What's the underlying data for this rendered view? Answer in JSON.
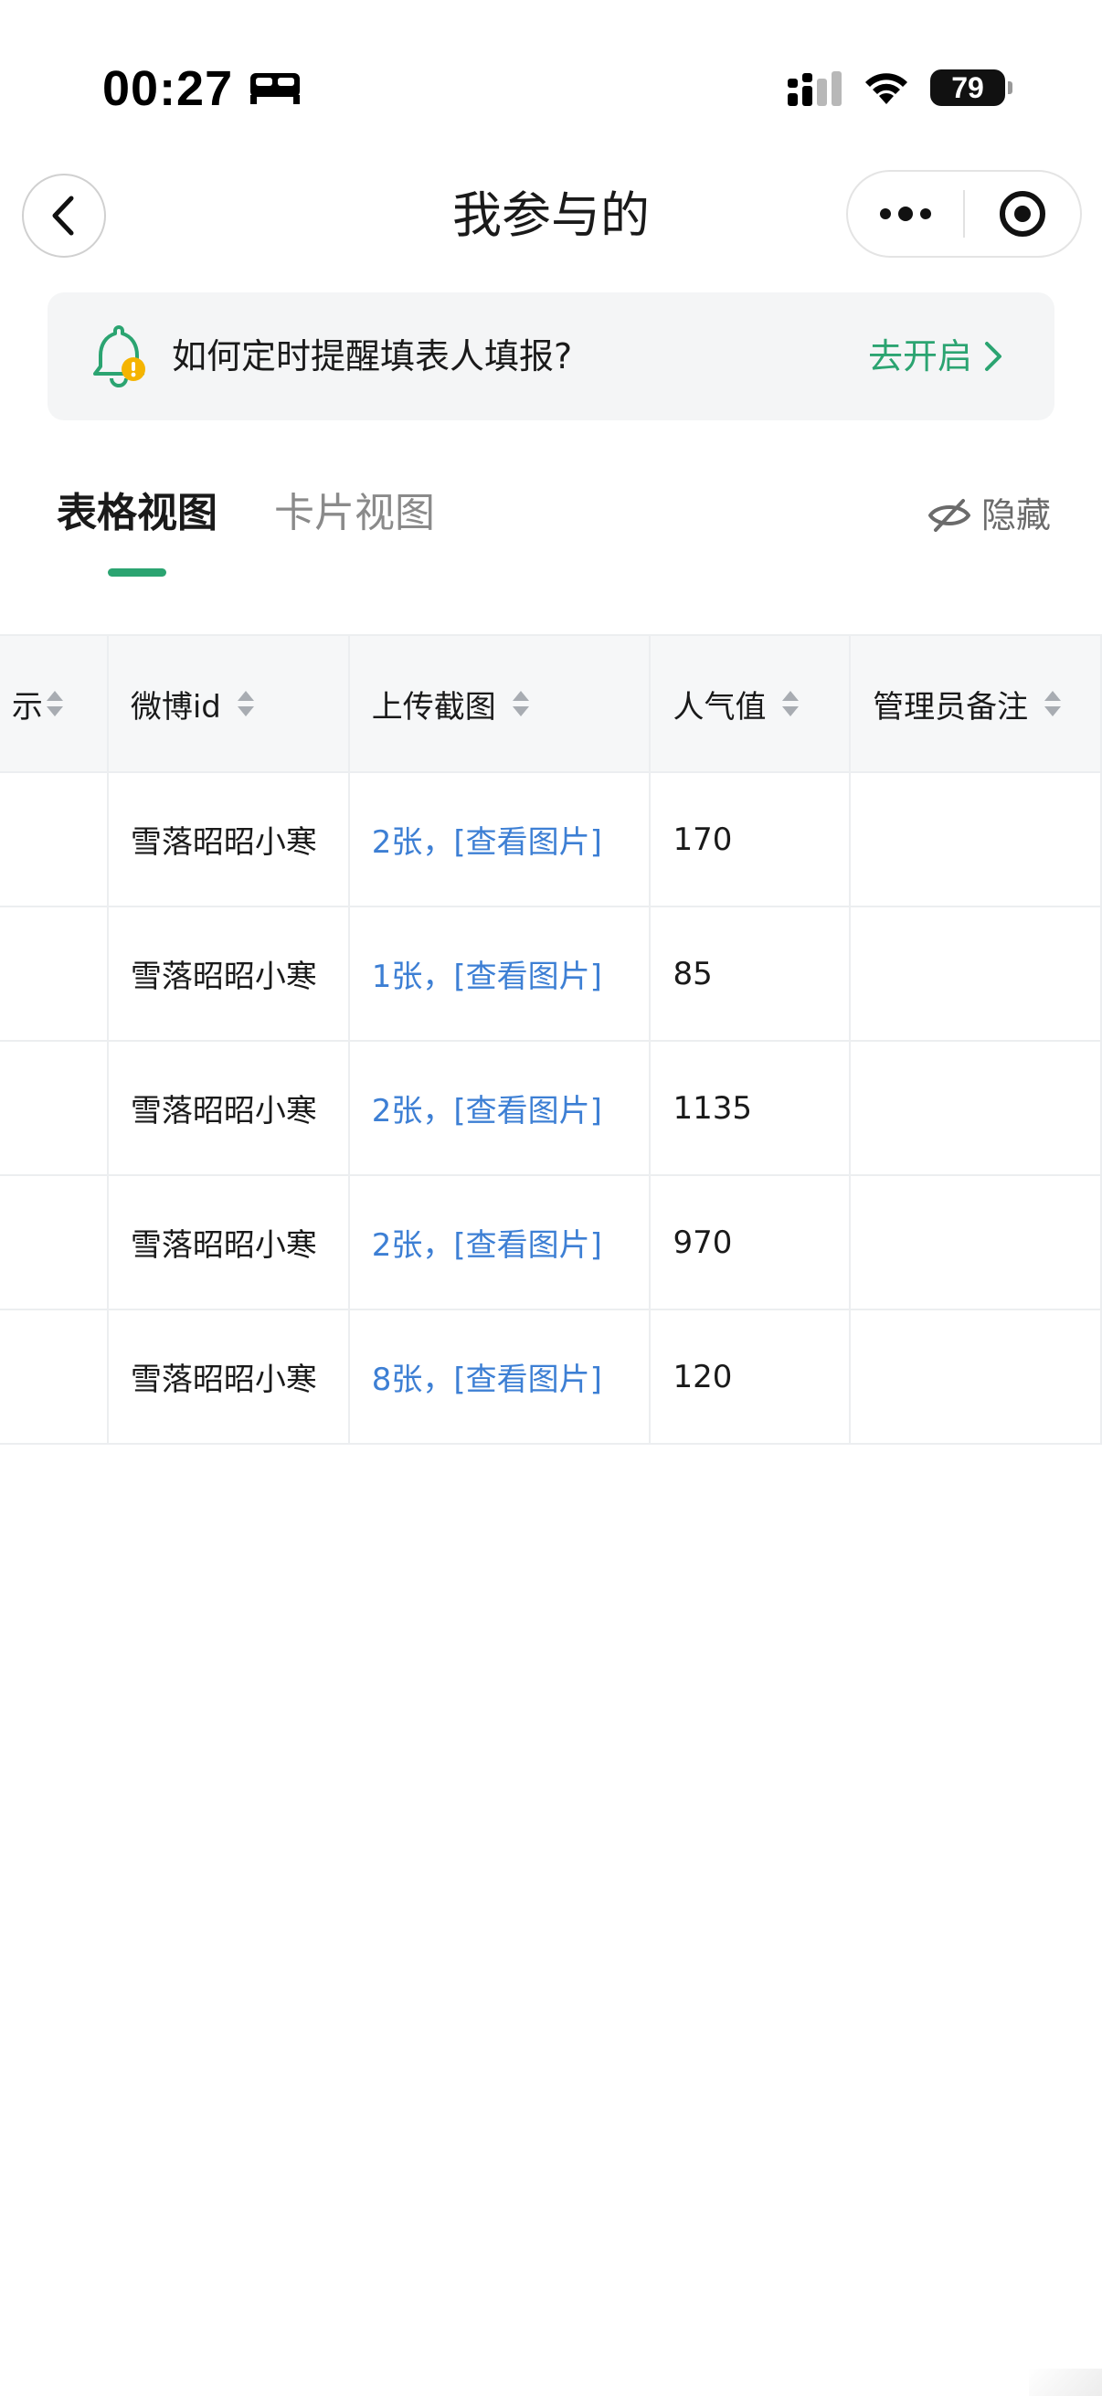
{
  "status_bar": {
    "time": "00:27",
    "battery": "79",
    "icons": [
      "sleep-icon",
      "signal-icon",
      "wifi-icon",
      "battery-icon"
    ]
  },
  "nav": {
    "title": "我参与的",
    "back_icon": "chevron-left-icon",
    "more_icon": "more-dots-icon",
    "close_icon": "target-circle-icon"
  },
  "banner": {
    "text": "如何定时提醒填表人填报?",
    "action": "去开启",
    "icon": "bell-warning-icon"
  },
  "tabs": {
    "items": [
      {
        "label": "表格视图",
        "active": true
      },
      {
        "label": "卡片视图",
        "active": false
      }
    ],
    "hide_label": "隐藏",
    "accent": "#2ba471"
  },
  "table": {
    "columns": [
      "示",
      "微博id",
      "上传截图",
      "人气值",
      "管理员备注"
    ],
    "rows": [
      {
        "weibo_id": "雪落昭昭小寒",
        "screenshots": "2张，[查看图片]",
        "popularity": "170",
        "note": ""
      },
      {
        "weibo_id": "雪落昭昭小寒",
        "screenshots": "1张，[查看图片]",
        "popularity": "85",
        "note": ""
      },
      {
        "weibo_id": "雪落昭昭小寒",
        "screenshots": "2张，[查看图片]",
        "popularity": "1135",
        "note": ""
      },
      {
        "weibo_id": "雪落昭昭小寒",
        "screenshots": "2张，[查看图片]",
        "popularity": "970",
        "note": ""
      },
      {
        "weibo_id": "雪落昭昭小寒",
        "screenshots": "8张，[查看图片]",
        "popularity": "120",
        "note": ""
      }
    ],
    "link_color": "#3d7fd4"
  }
}
